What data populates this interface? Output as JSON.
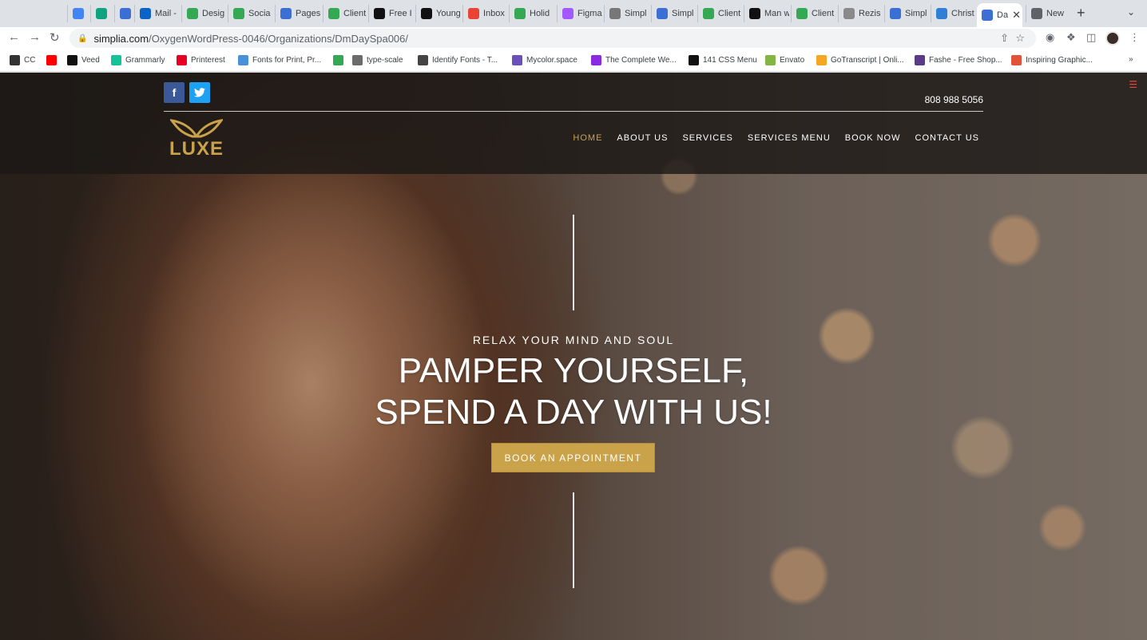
{
  "browser": {
    "tabs": [
      {
        "label": "",
        "icon": "drive-icon",
        "color": "#4285f4"
      },
      {
        "label": "",
        "icon": "chatgpt-icon",
        "color": "#10a37f"
      },
      {
        "label": "",
        "icon": "simplia-icon",
        "color": "#3b6fd4"
      },
      {
        "label": "Mail -",
        "icon": "outlook-icon",
        "color": "#0a64c8"
      },
      {
        "label": "Desig",
        "icon": "sheets-icon",
        "color": "#34a853"
      },
      {
        "label": "Socia",
        "icon": "sheets-icon",
        "color": "#34a853"
      },
      {
        "label": "Pages",
        "icon": "simplia-icon",
        "color": "#3b6fd4"
      },
      {
        "label": "Client",
        "icon": "sheets-icon",
        "color": "#34a853"
      },
      {
        "label": "Free I",
        "icon": "st-icon",
        "color": "#111111"
      },
      {
        "label": "Young",
        "icon": "st-icon",
        "color": "#111111"
      },
      {
        "label": "Inbox",
        "icon": "gmail-icon",
        "color": "#ea4335"
      },
      {
        "label": "Holid",
        "icon": "sheets-icon",
        "color": "#34a853"
      },
      {
        "label": "Figma",
        "icon": "figma-icon",
        "color": "#a259ff"
      },
      {
        "label": "Simpl",
        "icon": "simplia-icon",
        "color": "#777777"
      },
      {
        "label": "Simpl",
        "icon": "simplia-icon",
        "color": "#3b6fd4"
      },
      {
        "label": "Client",
        "icon": "sheets-icon",
        "color": "#34a853"
      },
      {
        "label": "Man w",
        "icon": "st-icon",
        "color": "#111111"
      },
      {
        "label": "Client",
        "icon": "sheets-icon",
        "color": "#34a853"
      },
      {
        "label": "Rezis",
        "icon": "globe-icon",
        "color": "#8a8a8a"
      },
      {
        "label": "Simpl",
        "icon": "simplia-icon",
        "color": "#3b6fd4"
      },
      {
        "label": "Christ",
        "icon": "ox-icon",
        "color": "#2f7fd6"
      },
      {
        "label": "Da",
        "icon": "simplia-icon",
        "color": "#3b6fd4",
        "active": true
      },
      {
        "label": "New",
        "icon": "chrome-icon",
        "color": "#5f6368"
      }
    ],
    "url_host": "simplia.com",
    "url_path": "/OxygenWordPress-0046/Organizations/DmDaySpa006/",
    "bookmarks": [
      {
        "label": "CC",
        "icon": "cc-icon",
        "color": "#333333"
      },
      {
        "label": "",
        "icon": "youtube-icon",
        "color": "#ff0000"
      },
      {
        "label": "Veed",
        "icon": "veed-icon",
        "color": "#111111"
      },
      {
        "label": "Grammarly",
        "icon": "grammarly-icon",
        "color": "#15c39a"
      },
      {
        "label": "Printerest",
        "icon": "pinterest-icon",
        "color": "#e60023"
      },
      {
        "label": "Fonts for Print, Pr...",
        "icon": "fonts-icon",
        "color": "#4a90d9"
      },
      {
        "label": "",
        "icon": "sheets-icon",
        "color": "#34a853"
      },
      {
        "label": "type-scale",
        "icon": "typescale-icon",
        "color": "#6b6b6b"
      },
      {
        "label": "Identify Fonts - T...",
        "icon": "identify-icon",
        "color": "#444444"
      },
      {
        "label": "Mycolor.space",
        "icon": "mycolor-icon",
        "color": "#6b4fbb"
      },
      {
        "label": "The Complete We...",
        "icon": "complete-icon",
        "color": "#8a2be2"
      },
      {
        "label": "141 CSS Menu",
        "icon": "cssmenu-icon",
        "color": "#111111"
      },
      {
        "label": "Envato",
        "icon": "envato-icon",
        "color": "#82b541"
      },
      {
        "label": "GoTranscript | Onli...",
        "icon": "gotranscript-icon",
        "color": "#f5a623"
      },
      {
        "label": "Fashe - Free Shop...",
        "icon": "fashe-icon",
        "color": "#5b3a8a"
      },
      {
        "label": "Inspiring Graphic...",
        "icon": "inspiring-icon",
        "color": "#e0533a"
      }
    ]
  },
  "site": {
    "phone": "808 988 5056",
    "logo_text": "LUXE",
    "nav": [
      "HOME",
      "ABOUT US",
      "SERVICES",
      "SERVICES MENU",
      "BOOK NOW",
      "CONTACT US"
    ],
    "hero_eyebrow": "RELAX YOUR MIND AND SOUL",
    "hero_line1": "PAMPER YOURSELF,",
    "hero_line2": "SPEND A DAY WITH US!",
    "cta_label": "BOOK AN APPOINTMENT",
    "accent": "#c9a24a"
  }
}
